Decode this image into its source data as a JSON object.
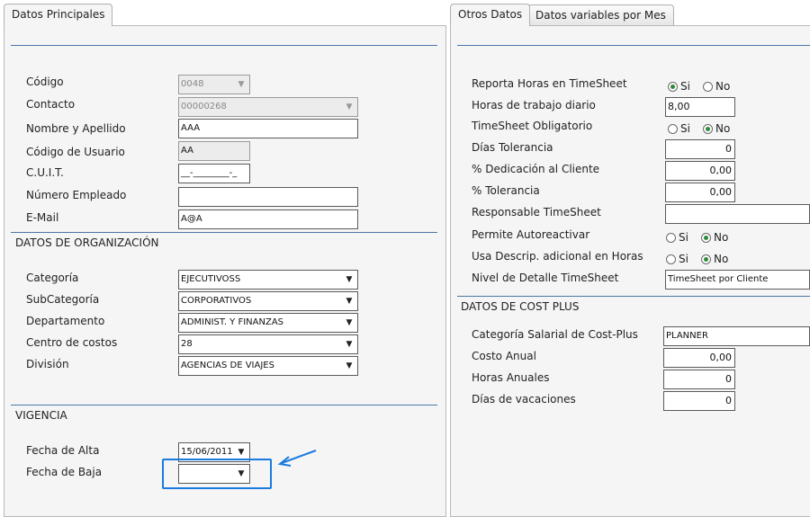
{
  "tabs_left": [
    {
      "label": "Datos Principales"
    }
  ],
  "tabs_right": [
    {
      "label": "Otros Datos"
    },
    {
      "label": "Datos variables por Mes"
    }
  ],
  "main": {
    "fields": {
      "codigo": {
        "label": "Código",
        "value": "0048"
      },
      "contacto": {
        "label": "Contacto",
        "value": "00000268"
      },
      "nombre": {
        "label": "Nombre y Apellido",
        "value": "AAA"
      },
      "codigo_usuario": {
        "label": "Código de Usuario",
        "value": "AA"
      },
      "cuit": {
        "label": "C.U.I.T.",
        "value": "__-________-_"
      },
      "numero_empleado": {
        "label": "Número Empleado",
        "value": ""
      },
      "email": {
        "label": "E-Mail",
        "value": "A@A"
      }
    }
  },
  "organizacion": {
    "title": "DATOS DE ORGANIZACIÓN",
    "categoria": {
      "label": "Categoría",
      "value": "EJECUTIVOSS"
    },
    "subcategoria": {
      "label": "SubCategoría",
      "value": "CORPORATIVOS"
    },
    "departamento": {
      "label": "Departamento",
      "value": "ADMINIST. Y FINANZAS"
    },
    "centro_costos": {
      "label": "Centro de costos",
      "value": "28"
    },
    "division": {
      "label": "División",
      "value": "AGENCIAS DE VIAJES"
    }
  },
  "vigencia": {
    "title": "VIGENCIA",
    "fecha_alta": {
      "label": "Fecha de Alta",
      "value": "15/06/2011"
    },
    "fecha_baja": {
      "label": "Fecha de Baja",
      "value": "  /  /"
    }
  },
  "otros": {
    "reporta_horas": {
      "label": "Reporta Horas en TimeSheet",
      "opt_si": "Si",
      "opt_no": "No",
      "selected": "si"
    },
    "horas_trabajo": {
      "label": "Horas de trabajo diario",
      "value": "8,00"
    },
    "timesheet_obligatorio": {
      "label": "TimeSheet Obligatorio",
      "opt_si": "Si",
      "opt_no": "No",
      "selected": "no"
    },
    "dias_tolerancia": {
      "label": "Días Tolerancia",
      "value": "0"
    },
    "dedicacion": {
      "label": "% Dedicación al Cliente",
      "value": "0,00"
    },
    "tolerancia": {
      "label": "% Tolerancia",
      "value": "0,00"
    },
    "responsable": {
      "label": "Responsable TimeSheet",
      "value": ""
    },
    "autoreactivar": {
      "label": "Permite Autoreactivar",
      "opt_si": "Si",
      "opt_no": "No",
      "selected": "no"
    },
    "descrip_adicional": {
      "label": "Usa Descrip. adicional en Horas",
      "opt_si": "Si",
      "opt_no": "No",
      "selected": "no"
    },
    "nivel_detalle": {
      "label": "Nivel de Detalle TimeSheet",
      "value": "TimeSheet por Cliente"
    }
  },
  "cost_plus": {
    "title": "DATOS DE COST PLUS",
    "categoria_salarial": {
      "label": "Categoría Salarial de Cost-Plus",
      "value": "PLANNER"
    },
    "costo_anual": {
      "label": "Costo Anual",
      "value": "0,00"
    },
    "horas_anuales": {
      "label": "Horas Anuales",
      "value": "0"
    },
    "dias_vacaciones": {
      "label": "Días de vacaciones",
      "value": "0"
    }
  },
  "colors": {
    "highlight": "#1a7ae0",
    "section_line": "#4a78a8",
    "radio_dot": "#2f8a3a"
  }
}
